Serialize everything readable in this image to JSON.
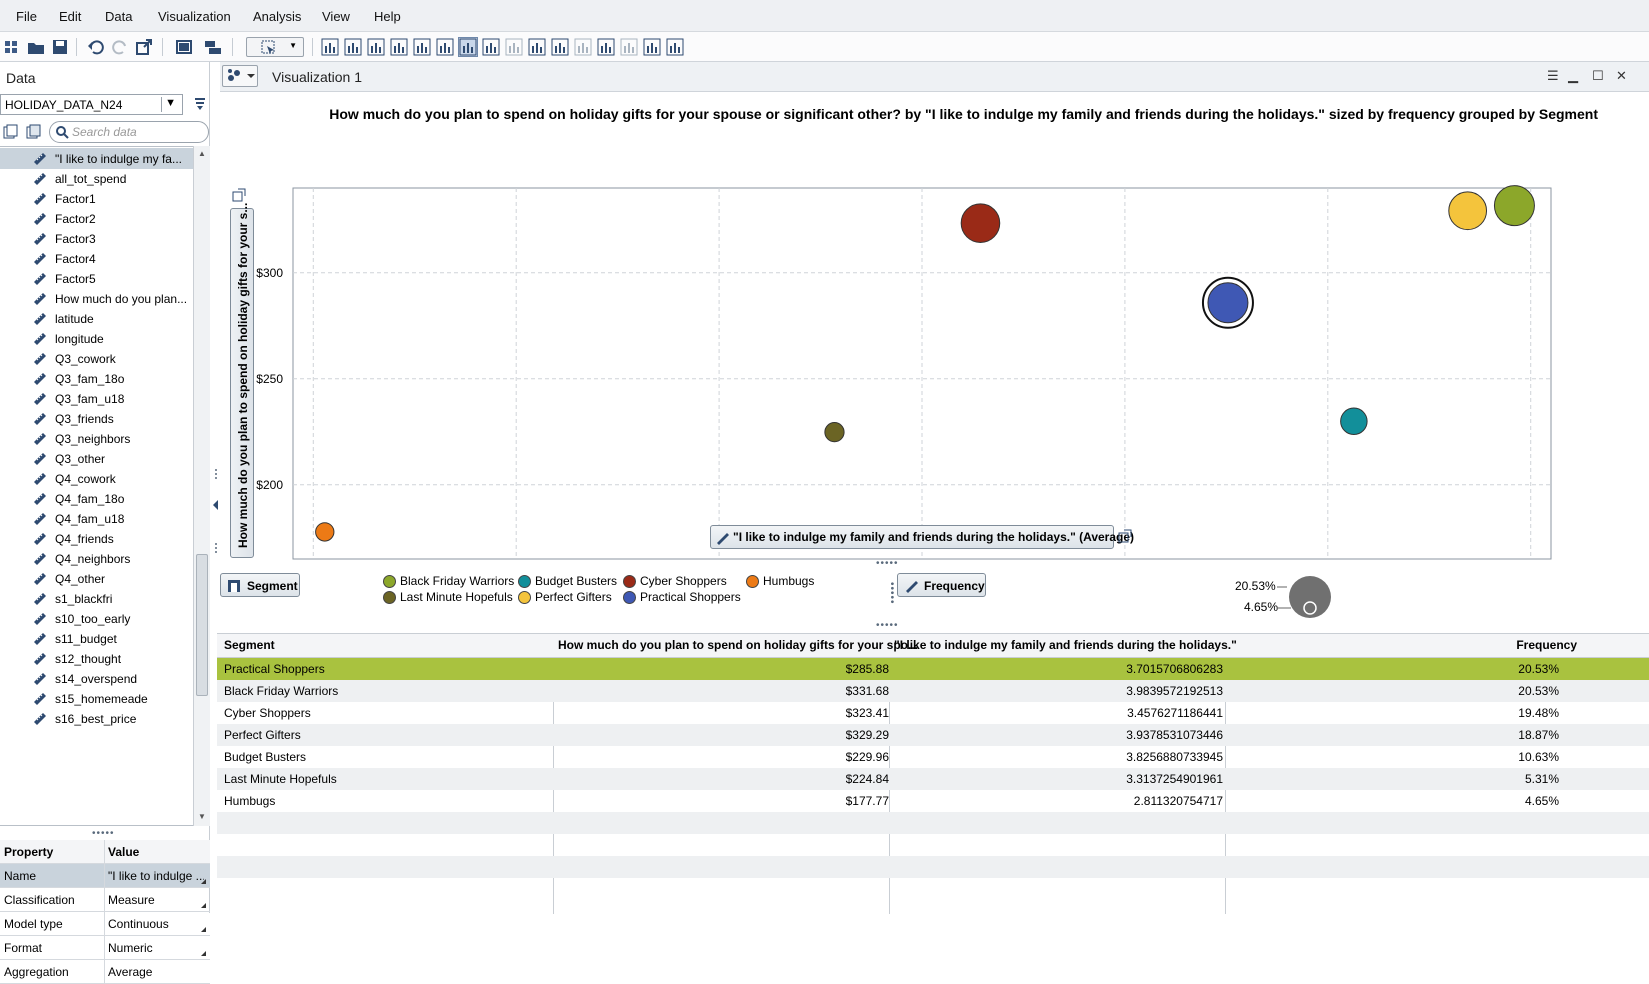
{
  "menu": [
    "File",
    "Edit",
    "Data",
    "Visualization",
    "Analysis",
    "View",
    "Help"
  ],
  "data_panel": {
    "title": "Data",
    "dataset": "HOLIDAY_DATA_N24",
    "search_placeholder": "Search data",
    "variables": [
      "\"I like to indulge my fa...",
      "all_tot_spend",
      "Factor1",
      "Factor2",
      "Factor3",
      "Factor4",
      "Factor5",
      "How much do you plan...",
      "latitude",
      "longitude",
      "Q3_cowork",
      "Q3_fam_18o",
      "Q3_fam_u18",
      "Q3_friends",
      "Q3_neighbors",
      "Q3_other",
      "Q4_cowork",
      "Q4_fam_18o",
      "Q4_fam_u18",
      "Q4_friends",
      "Q4_neighbors",
      "Q4_other",
      "s1_blackfri",
      "s10_too_early",
      "s11_budget",
      "s12_thought",
      "s14_overspend",
      "s15_homemeade",
      "s16_best_price"
    ],
    "selected_index": 0
  },
  "properties": {
    "header_property": "Property",
    "header_value": "Value",
    "rows": [
      {
        "key": "Name",
        "value": "\"I like to indulge ..."
      },
      {
        "key": "Classification",
        "value": "Measure"
      },
      {
        "key": "Model type",
        "value": "Continuous"
      },
      {
        "key": "Format",
        "value": "Numeric"
      },
      {
        "key": "Aggregation",
        "value": "Average"
      }
    ]
  },
  "visualization": {
    "tab_title": "Visualization 1",
    "chart_title": "How much do you plan to spend on holiday gifts for your spouse or significant other? by \"I like to indulge my family and friends during the holidays.\" sized by frequency grouped by Segment",
    "y_axis_label": "How much do you plan to spend on holiday gifts for your s...",
    "x_axis_label": "\"I like to indulge my family and friends during the holidays.\" (Average)",
    "segment_button": "Segment",
    "frequency_button": "Frequency",
    "size_legend_max": "20.53%",
    "size_legend_min": "4.65%"
  },
  "chart_data": {
    "type": "scatter",
    "xlim": [
      2.78,
      4.02
    ],
    "ylim": [
      165,
      340
    ],
    "x_ticks": [
      "2.8",
      "3.0",
      "3.2",
      "3.4",
      "3.6",
      "3.8",
      "4.0"
    ],
    "y_ticks": [
      "$200",
      "$250",
      "$300"
    ],
    "y_tick_values": [
      200,
      250,
      300
    ],
    "x_tick_values": [
      2.8,
      3.0,
      3.2,
      3.4,
      3.6,
      3.8,
      4.0
    ],
    "grid": true,
    "legend_position": "bottom-left",
    "series": [
      {
        "name": "Practical Shoppers",
        "x": 3.7015706806283,
        "y": 285.88,
        "size": 20.53,
        "color": "#3f58b4",
        "selected": true
      },
      {
        "name": "Black Friday Warriors",
        "x": 3.9839572192513,
        "y": 331.68,
        "size": 20.53,
        "color": "#8ca72a"
      },
      {
        "name": "Cyber Shoppers",
        "x": 3.4576271186441,
        "y": 323.41,
        "size": 19.48,
        "color": "#9a2a17"
      },
      {
        "name": "Perfect Gifters",
        "x": 3.9378531073446,
        "y": 329.29,
        "size": 18.87,
        "color": "#f4c43c"
      },
      {
        "name": "Budget Busters",
        "x": 3.8256880733945,
        "y": 229.96,
        "size": 10.63,
        "color": "#128f9a"
      },
      {
        "name": "Last Minute Hopefuls",
        "x": 3.3137254901961,
        "y": 224.84,
        "size": 5.31,
        "color": "#6b6424"
      },
      {
        "name": "Humbugs",
        "x": 2.811320754717,
        "y": 177.77,
        "size": 4.65,
        "color": "#ec7a16"
      }
    ]
  },
  "legend": [
    {
      "label": "Black Friday Warriors",
      "color": "#8ca72a"
    },
    {
      "label": "Budget Busters",
      "color": "#128f9a"
    },
    {
      "label": "Cyber Shoppers",
      "color": "#9a2a17"
    },
    {
      "label": "Humbugs",
      "color": "#ec7a16"
    },
    {
      "label": "Last Minute Hopefuls",
      "color": "#6b6424"
    },
    {
      "label": "Perfect Gifters",
      "color": "#f4c43c"
    },
    {
      "label": "Practical Shoppers",
      "color": "#3f58b4"
    }
  ],
  "table": {
    "headers": [
      "Segment",
      "How much do you plan to spend on holiday gifts for your spo...",
      "\"I like to indulge my family and friends during the holidays.\"",
      "Frequency"
    ],
    "rows": [
      [
        "Practical Shoppers",
        "$285.88",
        "3.7015706806283",
        "20.53%"
      ],
      [
        "Black Friday Warriors",
        "$331.68",
        "3.9839572192513",
        "20.53%"
      ],
      [
        "Cyber Shoppers",
        "$323.41",
        "3.4576271186441",
        "19.48%"
      ],
      [
        "Perfect Gifters",
        "$329.29",
        "3.9378531073446",
        "18.87%"
      ],
      [
        "Budget Busters",
        "$229.96",
        "3.8256880733945",
        "10.63%"
      ],
      [
        "Last Minute Hopefuls",
        "$224.84",
        "3.3137254901961",
        "5.31%"
      ],
      [
        "Humbugs",
        "$177.77",
        "2.811320754717",
        "4.65%"
      ]
    ],
    "highlight_row": 0,
    "highlight_color": "#a9c23f"
  }
}
